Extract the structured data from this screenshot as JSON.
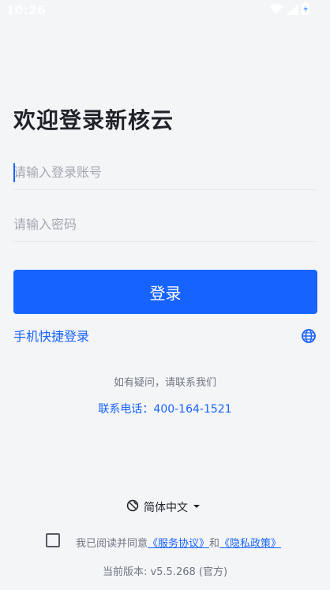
{
  "status_bar": {
    "time": "10:26",
    "wifi_icon": "wifi-icon",
    "signal_icon": "cellular-signal-icon",
    "battery_icon": "battery-charging-icon"
  },
  "login": {
    "title": "欢迎登录新核云",
    "account_placeholder": "请输入登录账号",
    "password_placeholder": "请输入密码",
    "login_button": "登录",
    "phone_login_link": "手机快捷登录",
    "language_icon": "globe-icon"
  },
  "support": {
    "help_text": "如有疑问，请联系我们",
    "phone": "联系电话：400-164-1521"
  },
  "footer": {
    "language": "简体中文",
    "agreement_prefix": "我已阅读并同意",
    "service_agreement": "《服务协议》",
    "connector": "和",
    "privacy_policy": "《隐私政策》",
    "version": "当前版本: v5.5.268 (官方)",
    "agreement_checked": false
  },
  "colors": {
    "brand_blue": "#1763ff",
    "background": "#f4f5f7",
    "title_text": "#1f2329",
    "muted_text": "#6f7682"
  }
}
